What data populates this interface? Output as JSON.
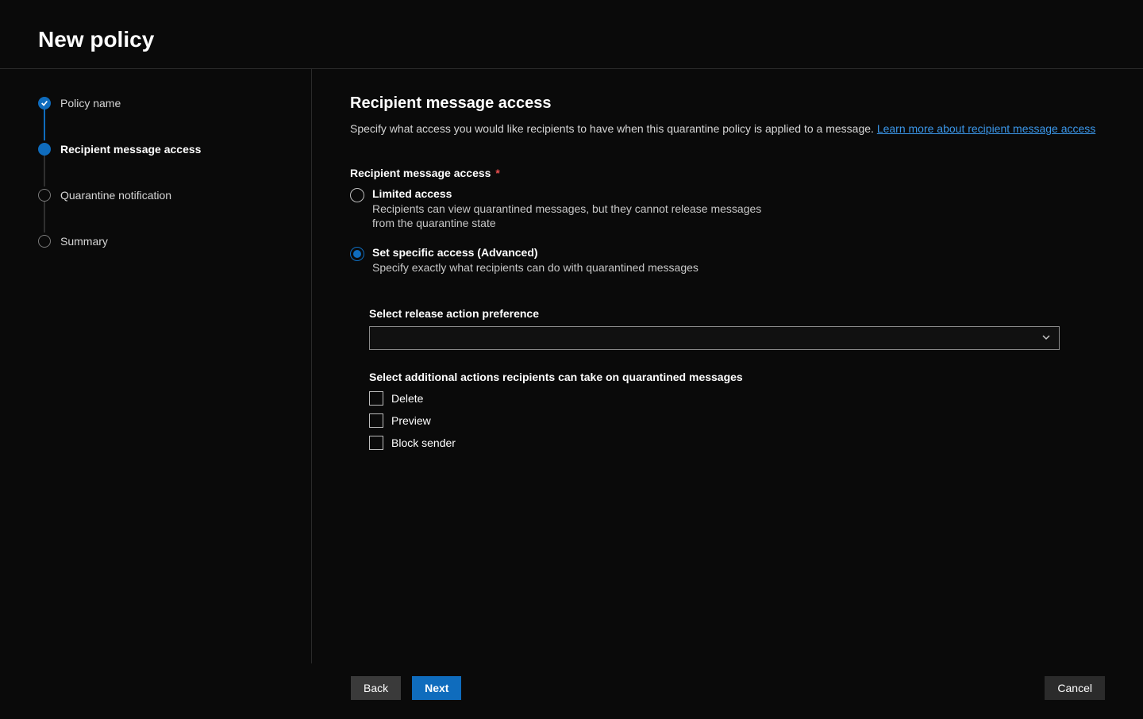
{
  "header": {
    "title": "New policy"
  },
  "steps": [
    {
      "label": "Policy name",
      "state": "done"
    },
    {
      "label": "Recipient message access",
      "state": "current"
    },
    {
      "label": "Quarantine notification",
      "state": "future"
    },
    {
      "label": "Summary",
      "state": "future"
    }
  ],
  "content": {
    "heading": "Recipient message access",
    "description_prefix": "Specify what access you would like recipients to have when this quarantine policy is applied to a message. ",
    "learn_more_text": "Learn more about recipient message access",
    "field_label": "Recipient message access",
    "required_marker": "*",
    "radios": [
      {
        "title": "Limited access",
        "sub": "Recipients can view quarantined messages, but they cannot release messages from the quarantine state",
        "selected": false
      },
      {
        "title": "Set specific access (Advanced)",
        "sub": "Specify exactly what recipients can do with quarantined messages",
        "selected": true
      }
    ],
    "advanced": {
      "select_label": "Select release action preference",
      "select_value": "",
      "check_label": "Select additional actions recipients can take on quarantined messages",
      "checks": [
        {
          "label": "Delete"
        },
        {
          "label": "Preview"
        },
        {
          "label": "Block sender"
        }
      ]
    }
  },
  "footer": {
    "back": "Back",
    "next": "Next",
    "cancel": "Cancel"
  }
}
